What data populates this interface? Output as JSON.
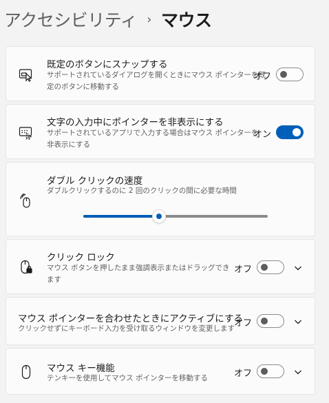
{
  "breadcrumb": {
    "parent": "アクセシビリティ",
    "separator": "›",
    "current": "マウス"
  },
  "snap_to_default": {
    "title": "既定のボタンにスナップする",
    "desc_line1": "サポートされているダイアログを開くときにマウス ポインターを既",
    "desc_line2": "定のボタンに移動する",
    "state": "オフ",
    "enabled": false
  },
  "hide_pointer_typing": {
    "title": "文字の入力中にポインターを非表示にする",
    "desc_line1": "サポートされているアプリで入力する場合はマウス ポインターを",
    "desc_line2": "非表示にする",
    "state": "オン",
    "enabled": true
  },
  "double_click_speed": {
    "title": "ダブル クリックの速度",
    "desc": "ダブルクリックするのに 2 回のクリックの間に必要な時間",
    "value_fraction": 0.41
  },
  "click_lock": {
    "title": "クリック ロック",
    "desc_line1": "マウス ボタンを押したまま強調表示またはドラッグでき",
    "desc_line2": "ます",
    "state": "オフ",
    "enabled": false
  },
  "activate_on_hover": {
    "title": "マウス ポインターを合わせたときにアクティブにする",
    "desc": "クリックせずにキーボード入力を受け取るウィンドウを変更します",
    "state": "オフ",
    "enabled": false
  },
  "mouse_keys": {
    "title": "マウス キー機能",
    "desc": "テンキーを使用してマウス ポインターを移動する",
    "state": "オフ",
    "enabled": false
  },
  "colors": {
    "accent": "#005fb8",
    "card_bg": "#fbfbfb",
    "page_bg": "#f3f3f3"
  }
}
